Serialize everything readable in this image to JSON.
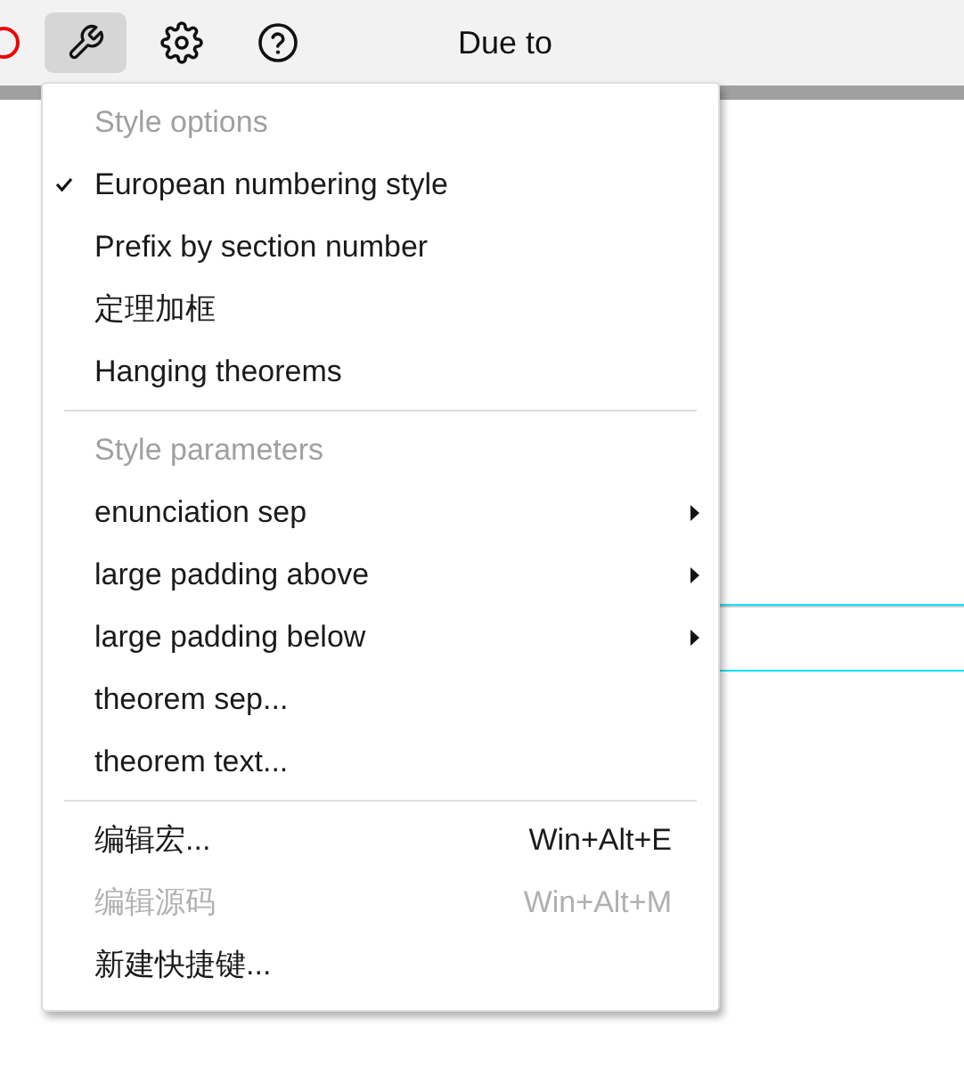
{
  "toolbar": {
    "buttons": [
      {
        "kind": "stop",
        "selected": false
      },
      {
        "kind": "tools",
        "selected": true
      },
      {
        "kind": "settings",
        "selected": false
      },
      {
        "kind": "help",
        "selected": false
      }
    ],
    "title": "Due to"
  },
  "menu": {
    "sections": [
      {
        "header": "Style options",
        "items": [
          {
            "kind": "check",
            "label": "European numbering style",
            "checked": true
          },
          {
            "kind": "check",
            "label": "Prefix by section number",
            "checked": false
          },
          {
            "kind": "check",
            "label": "定理加框",
            "checked": false
          },
          {
            "kind": "check",
            "label": "Hanging theorems",
            "checked": false
          }
        ]
      },
      {
        "header": "Style parameters",
        "items": [
          {
            "kind": "submenu",
            "label": "enunciation sep"
          },
          {
            "kind": "submenu",
            "label": "large padding above"
          },
          {
            "kind": "submenu",
            "label": "large padding below"
          },
          {
            "kind": "command",
            "label": "theorem sep...",
            "disabled": false
          },
          {
            "kind": "command",
            "label": "theorem text...",
            "disabled": false
          }
        ]
      },
      {
        "items": [
          {
            "kind": "command",
            "label": "编辑宏...",
            "shortcut": "Win+Alt+E",
            "disabled": false
          },
          {
            "kind": "command",
            "label": "编辑源码",
            "shortcut": "Win+Alt+M",
            "disabled": true
          },
          {
            "kind": "command",
            "label": "新建快捷键...",
            "disabled": false
          }
        ]
      }
    ]
  }
}
